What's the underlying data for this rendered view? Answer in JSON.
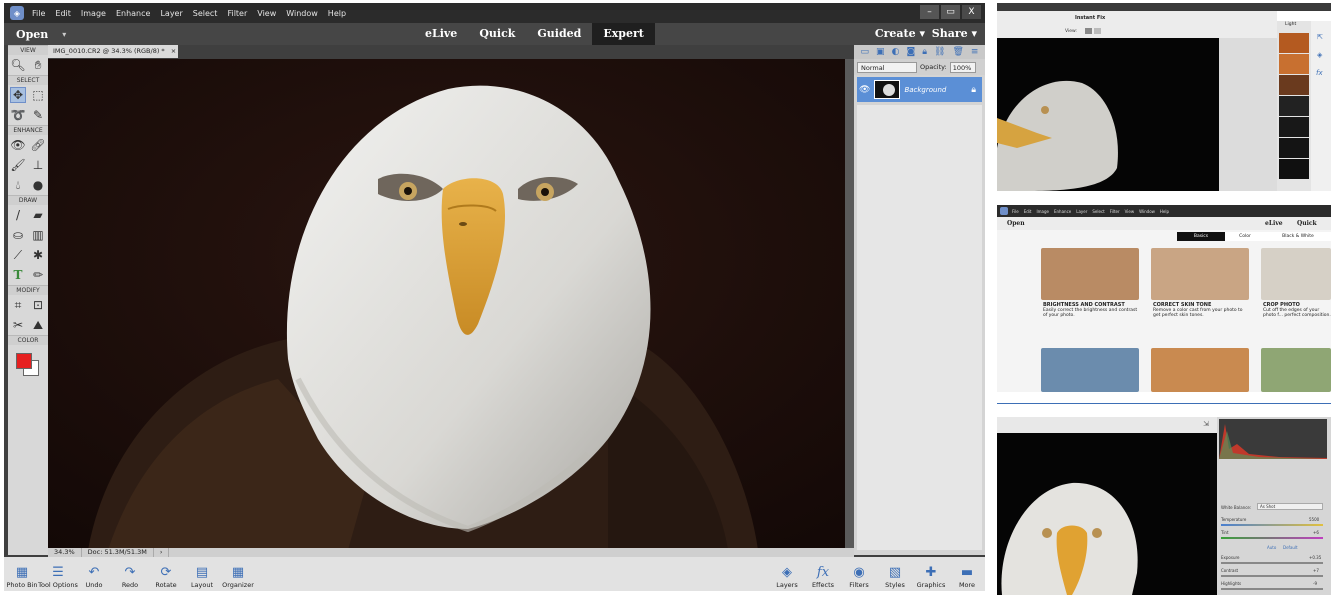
{
  "menubar": {
    "items": [
      "File",
      "Edit",
      "Image",
      "Enhance",
      "Layer",
      "Select",
      "Filter",
      "View",
      "Window",
      "Help"
    ],
    "window_buttons": [
      "–",
      "▭",
      "X"
    ]
  },
  "modebar": {
    "open_label": "Open",
    "modes": [
      "eLive",
      "Quick",
      "Guided",
      "Expert"
    ],
    "active_mode": "Expert",
    "create_label": "Create",
    "share_label": "Share"
  },
  "toolbox": {
    "sections": [
      "VIEW",
      "SELECT",
      "ENHANCE",
      "DRAW",
      "MODIFY",
      "COLOR"
    ],
    "colors": {
      "foreground": "#e62020",
      "background": "#ffffff"
    }
  },
  "document": {
    "tab_title": "IMG_0010.CR2 @ 34.3% (RGB/8) *",
    "zoom": "34.3%",
    "doc_size": "Doc: 51.3M/51.3M"
  },
  "layers_panel": {
    "blend_mode": "Normal",
    "opacity_label": "Opacity:",
    "opacity_value": "100%",
    "layer_name": "Background"
  },
  "bottombar": {
    "left_items": [
      "Photo Bin",
      "Tool Options",
      "Undo",
      "Redo",
      "Rotate",
      "Layout",
      "Organizer"
    ],
    "right_items": [
      "Layers",
      "Effects",
      "Filters",
      "Styles",
      "Graphics",
      "More"
    ]
  },
  "thumb1": {
    "title": "Instant Fix",
    "view_label": "View:",
    "panel_label": "Light"
  },
  "thumb2": {
    "menu_items": [
      "File",
      "Edit",
      "Image",
      "Enhance",
      "Layer",
      "Select",
      "Filter",
      "View",
      "Window",
      "Help"
    ],
    "open_label": "Open",
    "modes": [
      "eLive",
      "Quick"
    ],
    "tabs": [
      "Basics",
      "Color",
      "Black & White"
    ],
    "cards": [
      {
        "title": "BRIGHTNESS AND CONTRAST",
        "desc": "Easily correct the brightness and contrast of your photo."
      },
      {
        "title": "CORRECT SKIN TONE",
        "desc": "Remove a color cast from your photo to get perfect skin tones."
      },
      {
        "title": "CROP PHOTO",
        "desc": "Cut off the edges of your photo f... perfect composition."
      }
    ]
  },
  "thumb3": {
    "labels": [
      "White Balance:",
      "As Shot",
      "Temperature",
      "Tint",
      "Auto",
      "Default",
      "Exposure",
      "Contrast",
      "Highlights"
    ],
    "values": [
      "5500",
      "+6",
      "+0.35",
      "+7",
      "-9"
    ]
  },
  "theme": {
    "accent": "#5b8fd6",
    "canvas_bg": "#1c0e0a",
    "chrome_dark": "#2b2b2b"
  }
}
